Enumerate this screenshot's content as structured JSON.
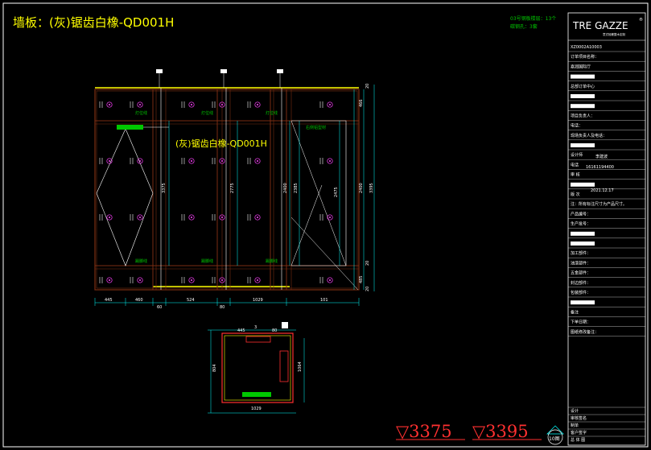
{
  "drawing": {
    "title": "墙板：(灰)锯齿白橡-QD001H",
    "center_label": "(灰)锯齿白橡-QD001H",
    "note_line1": "03号钢板楼层：13个",
    "note_line2": "碳钢孔：3套",
    "side_note": "右侧铝型材",
    "level_1": "▽3375",
    "level_2": "▽3395",
    "tag_1": "灯位线",
    "tag_2": "踢脚线"
  },
  "dimensions": {
    "bottom": [
      "445",
      "460",
      "60",
      "524",
      "80",
      "1029",
      "101"
    ],
    "vertical": [
      "3375",
      "2775",
      "2400",
      "2385",
      "2475",
      "2400",
      "3395"
    ],
    "right": [
      "20",
      "466",
      "485",
      "20",
      "20"
    ],
    "plan_top": [
      "445",
      "3",
      "80"
    ],
    "plan_bottom": "1029",
    "plan_left": "804",
    "plan_right": "1064"
  },
  "title_block": {
    "brand": "TRE GAZZE",
    "brand_sub": "意式轻奢整木定制",
    "rows": [
      "XZ0002A10003",
      "订单项目名称：",
      "嘉润国际厅",
      "",
      "总部订单中心",
      "",
      "",
      "项目负责人：",
      "电话：",
      "现场负责人及电话：",
      "",
      "设计师",
      "电话",
      "审 核",
      "",
      "版 次",
      "注：所有标注尺寸为产品尺寸。",
      "产品编号：",
      "生产批号：",
      "",
      "",
      "加工部件：",
      "油漆部件：",
      "五金部件：",
      "封边部件：",
      "包装部件：",
      "",
      "备注",
      "下单日期：",
      "图纸修改备注："
    ],
    "designer_name": "李建波",
    "phone": "16161194400",
    "date": "2021.12.17",
    "bottom_rows": [
      "设计",
      "审核签名",
      "制单",
      "客户签字",
      "总 体 图"
    ],
    "sheet": "总 体 图",
    "page": "10图"
  },
  "colors": {
    "line_white": "#ffffff",
    "line_yellow": "#ffff00",
    "line_cyan": "#00ffff",
    "line_red": "#ff3030",
    "line_brown": "#7a2d12",
    "green": "#00c800",
    "magenta": "#ff40ff"
  }
}
